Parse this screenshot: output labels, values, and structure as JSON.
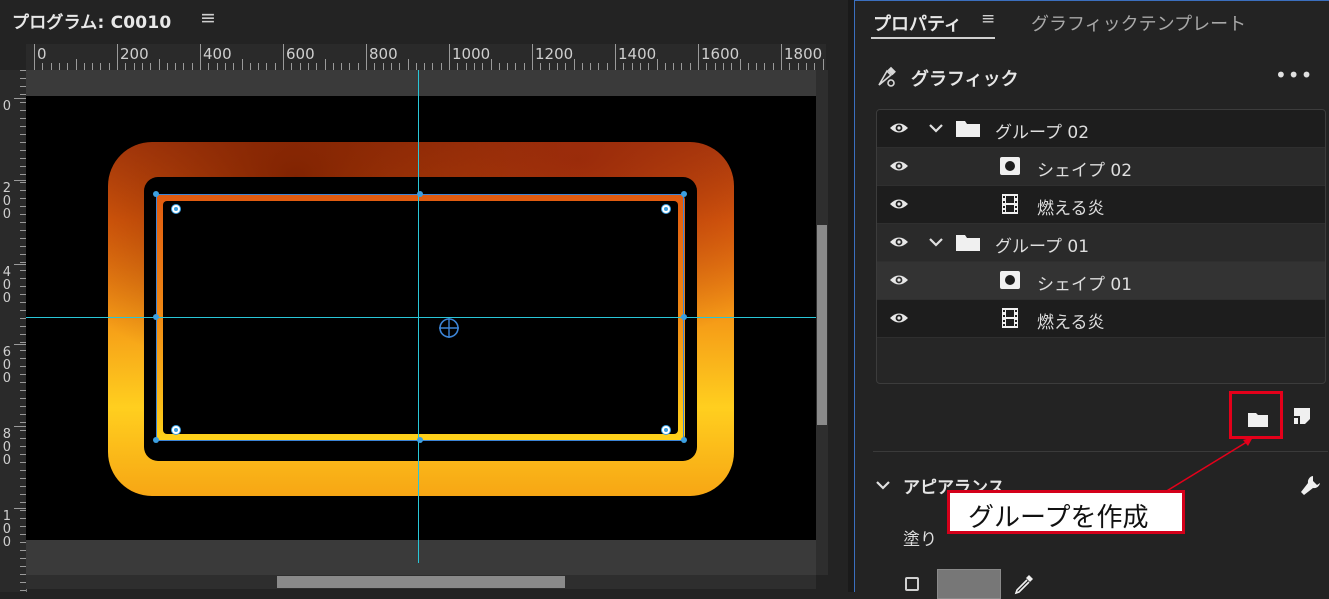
{
  "program_monitor": {
    "title": "プログラム: C0010",
    "menu_icon": "hamburger-icon",
    "ruler_labels": [
      "0",
      "200",
      "400",
      "600",
      "800",
      "1000",
      "1200",
      "1400",
      "1600",
      "1800"
    ],
    "vruler_labels": [
      "0",
      "2\n0\n0",
      "4\n0\n0",
      "6\n0\n0",
      "8\n0\n0",
      "1\n0\n0"
    ]
  },
  "properties_panel": {
    "tabs": [
      {
        "label": "プロパティ",
        "active": true
      },
      {
        "label": "グラフィックテンプレート",
        "active": false
      }
    ],
    "menu_icon": "hamburger-icon",
    "section_title": "グラフィック",
    "more_label": "•••",
    "layers": [
      {
        "label": "グループ 02",
        "type": "group",
        "visible": true,
        "expanded": true
      },
      {
        "label": "シェイプ 02",
        "type": "shape",
        "visible": true
      },
      {
        "label": "燃える炎",
        "type": "clip",
        "visible": true
      },
      {
        "label": "グループ 01",
        "type": "group",
        "visible": true,
        "expanded": true
      },
      {
        "label": "シェイプ 01",
        "type": "shape",
        "visible": true
      },
      {
        "label": "燃える炎",
        "type": "clip",
        "visible": true
      }
    ],
    "appearance": {
      "title": "アピアランス",
      "fill_label": "塗り",
      "fill_color": "#777777"
    }
  },
  "annotation": {
    "callout_text": "グループを作成",
    "color": "#e4001a"
  },
  "colors": {
    "guide": "#29c6d8",
    "selection": "#3c84d6",
    "panel_bg": "#232323"
  }
}
